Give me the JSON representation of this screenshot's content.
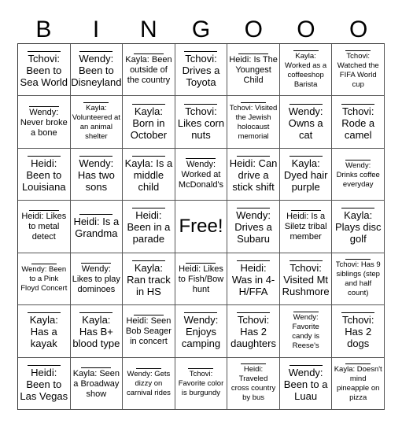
{
  "header": [
    "B",
    "I",
    "N",
    "G",
    "O",
    "O",
    "O"
  ],
  "cells": [
    {
      "text": "Tchovi: Been to Sea World",
      "size": "l"
    },
    {
      "text": "Wendy: Been to Disneyland",
      "size": "l"
    },
    {
      "text": "Kayla: Been outside of the country",
      "size": "m"
    },
    {
      "text": "Tchovi: Drives a Toyota",
      "size": "l"
    },
    {
      "text": "Heidi: Is The Youngest Child",
      "size": "m"
    },
    {
      "text": "Kayla: Worked as a coffeeshop Barista",
      "size": "s"
    },
    {
      "text": "Tchovi: Watched the FIFA World cup",
      "size": "s"
    },
    {
      "text": "Wendy: Never broke a bone",
      "size": "m"
    },
    {
      "text": "Kayla: Volunteered at an animal shelter",
      "size": "s"
    },
    {
      "text": "Kayla: Born in October",
      "size": "l"
    },
    {
      "text": "Tchovi: Likes corn nuts",
      "size": "l"
    },
    {
      "text": "Tchovi: Visited the Jewish holocaust memorial",
      "size": "s"
    },
    {
      "text": "Wendy: Owns a cat",
      "size": "l"
    },
    {
      "text": "Tchovi: Rode a camel",
      "size": "l"
    },
    {
      "text": "Heidi: Been to Louisiana",
      "size": "l"
    },
    {
      "text": "Wendy: Has two sons",
      "size": "l"
    },
    {
      "text": "Kayla: Is a middle child",
      "size": "l"
    },
    {
      "text": "Wendy: Worked at McDonald's",
      "size": "m"
    },
    {
      "text": "Heidi: Can drive a stick shift",
      "size": "l"
    },
    {
      "text": "Kayla: Dyed hair purple",
      "size": "l"
    },
    {
      "text": "Wendy: Drinks coffee everyday",
      "size": "s"
    },
    {
      "text": "Heidi: Likes to metal detect",
      "size": "m"
    },
    {
      "text": "Heidi: Is a Grandma",
      "size": "l"
    },
    {
      "text": "Heidi: Been in a parade",
      "size": "l"
    },
    {
      "text": "Free!",
      "size": "free"
    },
    {
      "text": "Wendy: Drives a Subaru",
      "size": "l"
    },
    {
      "text": "Heidi: Is a Siletz tribal member",
      "size": "m"
    },
    {
      "text": "Kayla: Plays disc golf",
      "size": "l"
    },
    {
      "text": "Wendy: Been to a Pink Floyd Concert",
      "size": "s"
    },
    {
      "text": "Wendy: Likes to play dominoes",
      "size": "m"
    },
    {
      "text": "Kayla: Ran track in HS",
      "size": "l"
    },
    {
      "text": "Heidi: Likes to Fish/Bow hunt",
      "size": "m"
    },
    {
      "text": "Heidi: Was in 4-H/FFA",
      "size": "l"
    },
    {
      "text": "Tchovi: Visited Mt Rushmore",
      "size": "l"
    },
    {
      "text": "Tchovi: Has 9 siblings (step and half count)",
      "size": "s"
    },
    {
      "text": "Kayla: Has a kayak",
      "size": "l"
    },
    {
      "text": "Kayla: Has B+ blood type",
      "size": "l"
    },
    {
      "text": "Heidi: Seen Bob Seager in concert",
      "size": "m"
    },
    {
      "text": "Wendy: Enjoys camping",
      "size": "l"
    },
    {
      "text": "Tchovi: Has 2 daughters",
      "size": "l"
    },
    {
      "text": "Wendy: Favorite candy is Reese's",
      "size": "s"
    },
    {
      "text": "Tchovi: Has 2 dogs",
      "size": "l"
    },
    {
      "text": "Heidi: Been to Las Vegas",
      "size": "l"
    },
    {
      "text": "Kayla: Seen a Broadway show",
      "size": "m"
    },
    {
      "text": "Wendy: Gets dizzy on carnival rides",
      "size": "s"
    },
    {
      "text": "Tchovi: Favorite color is burgundy",
      "size": "s"
    },
    {
      "text": "Heidi: Traveled cross country by bus",
      "size": "s"
    },
    {
      "text": "Wendy: Been to a Luau",
      "size": "l"
    },
    {
      "text": "Kayla: Doesn't mind pineapple on pizza",
      "size": "s"
    }
  ]
}
